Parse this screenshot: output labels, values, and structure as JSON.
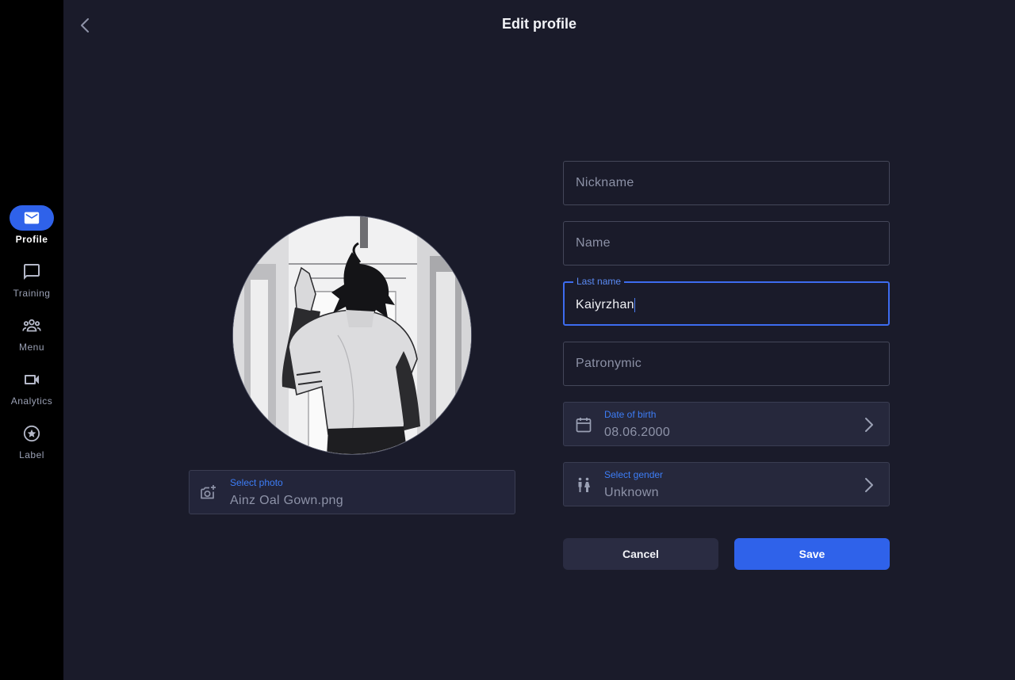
{
  "nav": {
    "items": [
      {
        "label": "Profile",
        "icon": "mail-icon",
        "active": true
      },
      {
        "label": "Training",
        "icon": "chat-bubble-icon",
        "active": false
      },
      {
        "label": "Menu",
        "icon": "group-icon",
        "active": false
      },
      {
        "label": "Analytics",
        "icon": "videocam-icon",
        "active": false
      },
      {
        "label": "Label",
        "icon": "star-circle-icon",
        "active": false
      }
    ]
  },
  "header": {
    "title": "Edit profile",
    "back_icon": "chevron-left-icon"
  },
  "photo": {
    "label": "Select photo",
    "value": "Ainz Oal Gown.png",
    "icon": "add-photo-icon"
  },
  "form": {
    "nickname": {
      "placeholder": "Nickname",
      "value": ""
    },
    "name": {
      "placeholder": "Name",
      "value": ""
    },
    "last_name": {
      "label": "Last name",
      "value": "Kaiyrzhan"
    },
    "patronymic": {
      "placeholder": "Patronymic",
      "value": ""
    },
    "date_of_birth": {
      "label": "Date of birth",
      "value": "08.06.2000",
      "icon": "calendar-icon"
    },
    "gender": {
      "label": "Select gender",
      "value": "Unknown",
      "icon": "wc-icon"
    }
  },
  "actions": {
    "cancel_label": "Cancel",
    "save_label": "Save"
  },
  "colors": {
    "accent": "#2f62ea",
    "background": "#1a1b2a",
    "rail": "#000000",
    "field_fill": "#26283c",
    "label_blue": "#3d7df6"
  }
}
